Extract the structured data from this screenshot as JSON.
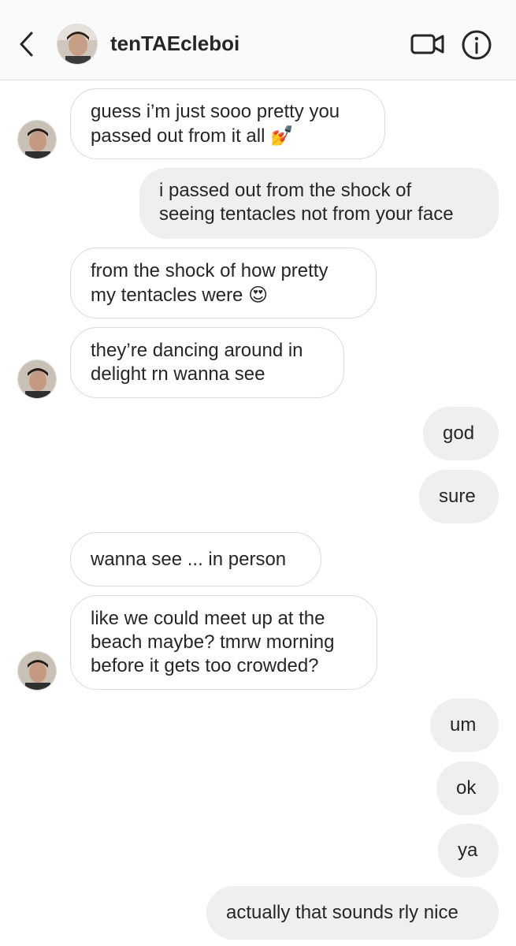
{
  "header": {
    "username": "tenTAEcleboi",
    "back_icon": "chevron-left-icon",
    "video_icon": "video-camera-icon",
    "info_icon": "info-icon"
  },
  "messages": [
    {
      "sender": "them",
      "lines": [
        "guess i’m just sooo pretty you",
        "passed out from it all"
      ],
      "emoji": "💅"
    },
    {
      "sender": "me",
      "lines": [
        "i passed out from the shock of",
        "seeing tentacles not from your face"
      ]
    },
    {
      "sender": "them",
      "lines": [
        "from the shock of how pretty",
        "my tentacles were"
      ],
      "emoji": "😍"
    },
    {
      "sender": "them",
      "lines": [
        "they’re dancing around in",
        "delight rn wanna see"
      ]
    },
    {
      "sender": "me",
      "lines": [
        "god"
      ]
    },
    {
      "sender": "me",
      "lines": [
        "sure"
      ]
    },
    {
      "sender": "them",
      "lines": [
        "wanna see ... in person"
      ]
    },
    {
      "sender": "them",
      "lines": [
        "like we could meet up at the",
        "beach maybe? tmrw morning",
        "before it gets too crowded?"
      ]
    },
    {
      "sender": "me",
      "lines": [
        "um"
      ]
    },
    {
      "sender": "me",
      "lines": [
        "ok"
      ]
    },
    {
      "sender": "me",
      "lines": [
        "ya"
      ]
    },
    {
      "sender": "me",
      "lines": [
        "actually that sounds rly nice"
      ]
    }
  ]
}
